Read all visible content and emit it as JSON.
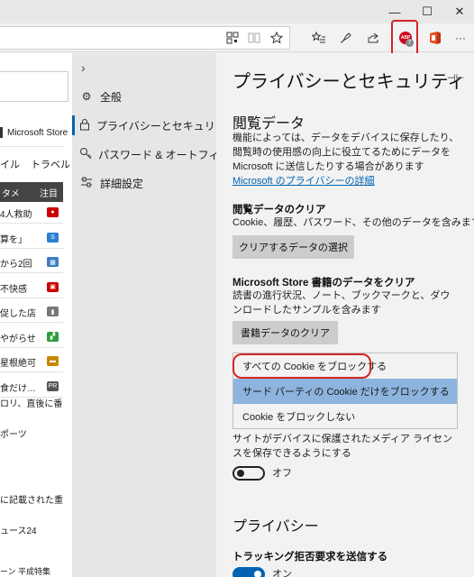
{
  "window": {
    "minimize": "—",
    "maximize": "☐",
    "close": "✕"
  },
  "toolbar": {
    "extension_badge": "7",
    "extension_logo": "ABP",
    "more": "···"
  },
  "background_page": {
    "store_link": "Microsoft Store",
    "tabs": [
      "イル",
      "トラベル"
    ],
    "news_header": {
      "left": "タメ",
      "right": "注目"
    },
    "news": [
      {
        "text": "4人救助",
        "icon": "●",
        "color": "#cc0000"
      },
      {
        "text": "算を」",
        "icon": "S",
        "color": "#2a7fcf"
      },
      {
        "text": "から2回",
        "icon": "▦",
        "color": "#3a7dc1"
      },
      {
        "text": "不快感",
        "icon": "▣",
        "color": "#c00"
      },
      {
        "text": "促した店",
        "icon": "▮",
        "color": "#777"
      },
      {
        "text": "やがらせ",
        "icon": "▞",
        "color": "#2e9c3a"
      },
      {
        "text": "星根絶可",
        "icon": "▬",
        "color": "#c58800"
      },
      {
        "text": "食だけ…",
        "icon": "PR",
        "color": "#555"
      }
    ],
    "article1": [
      "ロリ、直後に番",
      "",
      "ポーツ"
    ],
    "article2": [
      "に記載された重",
      "",
      "ュース24"
    ],
    "bottom": "ーン     平成特集"
  },
  "nav": {
    "collapse": "›",
    "items": [
      {
        "icon": "gear-icon",
        "glyph": "⚙",
        "label": "全般"
      },
      {
        "icon": "lock-icon",
        "glyph": "🔒",
        "label": "プライバシーとセキュリティ"
      },
      {
        "icon": "key-icon",
        "glyph": "⚷",
        "label": "パスワード & オートフィル"
      },
      {
        "icon": "sliders-icon",
        "glyph": "☰",
        "label": "詳細設定"
      }
    ]
  },
  "panel": {
    "title": "プライバシーとセキュリティ",
    "pin": "⊣⊢",
    "browsing_heading": "閲覧データ",
    "browsing_desc": "機能によっては、データをデバイスに保存したり、閲覧時の使用感の向上に役立てるためにデータを Microsoft に送信したりする場合があります",
    "privacy_link": "Microsoft のプライバシーの詳細",
    "clear_heading": "閲覧データのクリア",
    "clear_desc": "Cookie、履歴、パスワード、その他のデータを含みます",
    "clear_button": "クリアするデータの選択",
    "store_heading": "Microsoft Store 書籍のデータをクリア",
    "store_desc": "読書の進行状況、ノート、ブックマークと、ダウンロードしたサンプルを含みます",
    "store_button": "書籍データのクリア",
    "cookie_options": [
      "すべての Cookie をブロックする",
      "サード パーティの Cookie だけをブロックする",
      "Cookie をブロックしない"
    ],
    "media_desc": "サイトがデバイスに保護されたメディア ライセンスを保存できるようにする",
    "media_toggle": "オフ",
    "privacy_heading": "プライバシー",
    "dnt_heading": "トラッキング拒否要求を送信する",
    "dnt_toggle": "オン"
  }
}
